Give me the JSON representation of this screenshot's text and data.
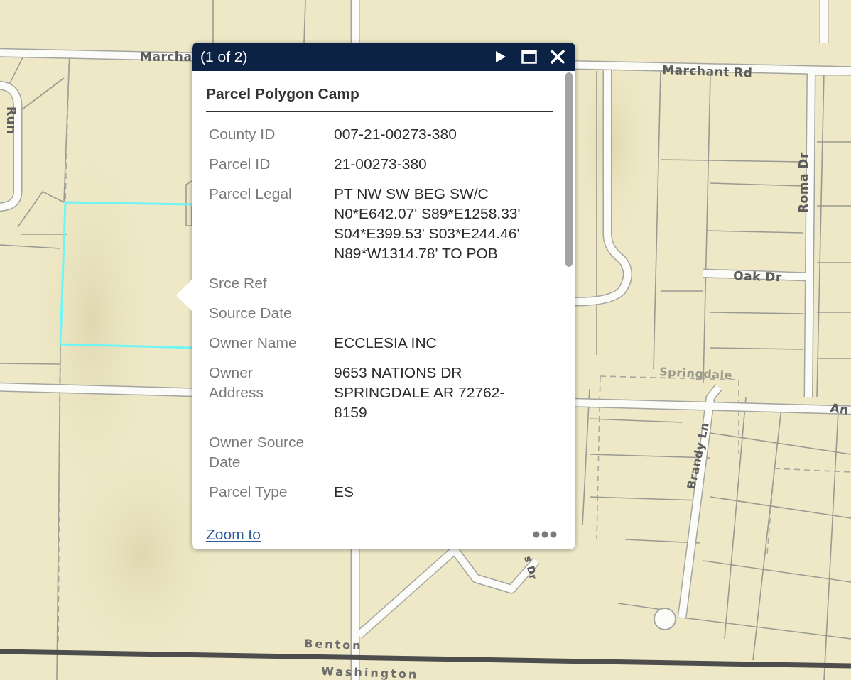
{
  "map": {
    "labels": [
      {
        "text": "Marcha",
        "kind": "road"
      },
      {
        "text": "Run",
        "kind": "road"
      },
      {
        "text": "Marchant Rd",
        "kind": "road"
      },
      {
        "text": "Roma Dr",
        "kind": "road"
      },
      {
        "text": "Oak Dr",
        "kind": "road"
      },
      {
        "text": "Springdale",
        "kind": "city"
      },
      {
        "text": "An",
        "kind": "road"
      },
      {
        "text": "Brandy Ln",
        "kind": "road"
      },
      {
        "text": "s Dr",
        "kind": "road"
      },
      {
        "text": "Benton",
        "kind": "county"
      },
      {
        "text": "Washington",
        "kind": "county"
      }
    ]
  },
  "popup": {
    "pager": "(1 of 2)",
    "title": "Parcel Polygon Camp",
    "fields": [
      {
        "label": [
          "County ID"
        ],
        "value": [
          "007-21-00273-380"
        ]
      },
      {
        "label": [
          "Parcel ID"
        ],
        "value": [
          "21-00273-380"
        ]
      },
      {
        "label": [
          "Parcel Legal"
        ],
        "value": [
          "PT NW SW BEG SW/C",
          "N0*E642.07' S89*E1258.33'",
          "S04*E399.53' S03*E244.46'",
          "N89*W1314.78' TO POB"
        ]
      },
      {
        "label": [
          "Srce Ref"
        ]
      },
      {
        "label": [
          "Source Date"
        ]
      },
      {
        "label": [
          "Owner Name"
        ],
        "value": [
          "ECCLESIA INC"
        ]
      },
      {
        "label": [
          "Owner",
          "Address"
        ],
        "value": [
          "9653 NATIONS DR",
          "SPRINGDALE AR 72762-",
          "8159"
        ]
      },
      {
        "label": [
          "Owner Source",
          "Date"
        ]
      },
      {
        "label": [
          "Parcel Type"
        ],
        "value": [
          "ES"
        ]
      }
    ],
    "link": "Zoom to"
  }
}
